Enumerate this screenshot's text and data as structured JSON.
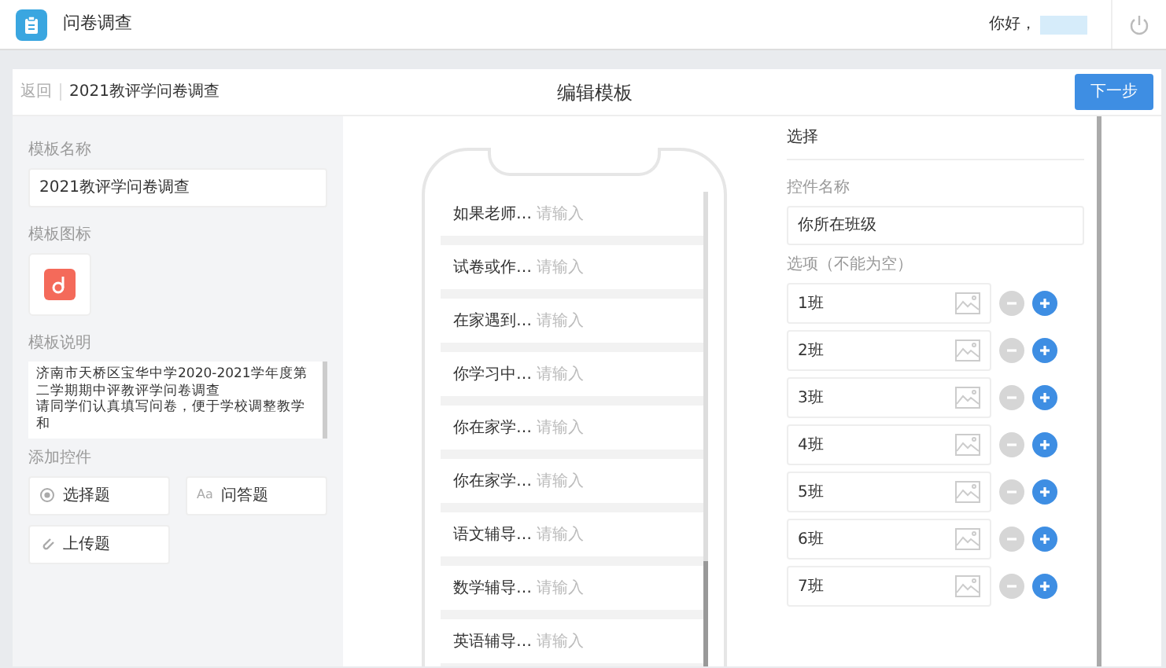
{
  "app": {
    "title": "问卷调查",
    "greeting": "你好，"
  },
  "toolbar": {
    "back": "返回",
    "template_name": "2021教评学问卷调查",
    "title": "编辑模板",
    "next": "下一步"
  },
  "sidebar": {
    "name_label": "模板名称",
    "name_value": "2021教评学问卷调查",
    "icon_label": "模板图标",
    "desc_label": "模板说明",
    "desc_lines": [
      "济南市天桥区宝华中学2020-2021学年度第二学期期中评教评学问卷调查",
      "请同学们认真填写问卷，便于学校调整教学和"
    ],
    "controls_label": "添加控件",
    "controls": [
      {
        "kind": "choice",
        "label": "选择题"
      },
      {
        "kind": "text",
        "icon_text": "Aa",
        "label": "问答题"
      },
      {
        "kind": "upload",
        "label": "上传题"
      }
    ]
  },
  "preview": {
    "items": [
      {
        "label": "如果老师…",
        "placeholder": "请输入"
      },
      {
        "label": "试卷或作…",
        "placeholder": "请输入"
      },
      {
        "label": "在家遇到…",
        "placeholder": "请输入"
      },
      {
        "label": "你学习中…",
        "placeholder": "请输入"
      },
      {
        "label": "你在家学…",
        "placeholder": "请输入"
      },
      {
        "label": "你在家学…",
        "placeholder": "请输入"
      },
      {
        "label": "语文辅导…",
        "placeholder": "请输入"
      },
      {
        "label": "数学辅导…",
        "placeholder": "请输入"
      },
      {
        "label": "英语辅导…",
        "placeholder": "请输入"
      }
    ]
  },
  "properties": {
    "title": "选择",
    "name_label": "控件名称",
    "name_value": "你所在班级",
    "options_label": "选项（不能为空）",
    "options": [
      "1班",
      "2班",
      "3班",
      "4班",
      "5班",
      "6班",
      "7班"
    ]
  }
}
